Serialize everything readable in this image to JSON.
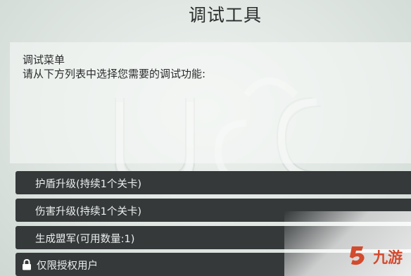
{
  "header": {
    "title": "调试工具"
  },
  "description": {
    "title": "调试菜单",
    "subtitle": "请从下方列表中选择您需要的调试功能:"
  },
  "menu": {
    "items": [
      {
        "label": "护盾升级(持续1个关卡)",
        "locked": false
      },
      {
        "label": "伤害升级(持续1个关卡)",
        "locked": false
      },
      {
        "label": "生成盟军(可用数量:1)",
        "locked": false
      },
      {
        "label": "仅限授权用户",
        "locked": true,
        "icon": "lock-icon"
      }
    ]
  },
  "watermark": {
    "text": "九游",
    "icon": "jiuyou-logo-icon",
    "color": "#d34a2d"
  },
  "colors": {
    "menu_bg": "#35393a",
    "menu_text": "#ecefee",
    "background": "#dfe6e2"
  }
}
